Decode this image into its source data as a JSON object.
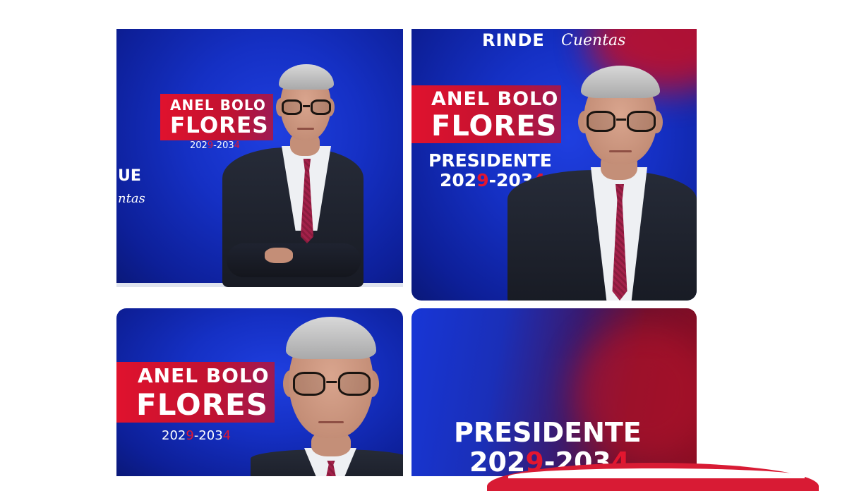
{
  "tile1": {
    "name_line1": "ANEL BOLO",
    "name_line2": "FLORES",
    "years_a": "202",
    "years_b": "9",
    "years_c": "-203",
    "years_d": "4",
    "edge_text1": "UE",
    "edge_text2": "ntas"
  },
  "tile2": {
    "rinde": "RINDE",
    "cuentas": "Cuentas",
    "name_line1": "ANEL BOLO",
    "name_line2": "FLORES",
    "presidente": "PRESIDENTE",
    "years_a": "202",
    "years_b": "9",
    "years_c": "-203",
    "years_d": "4",
    "edge_text": "P"
  },
  "tile3": {
    "name_line1": "ANEL BOLO",
    "name_line2": "FLORES",
    "years_a": "202",
    "years_b": "9",
    "years_c": "-203",
    "years_d": "4"
  },
  "tile4": {
    "presidente": "PRESIDENTE",
    "years_a": "202",
    "years_b": "9",
    "years_c": "-203",
    "years_d": "4"
  },
  "colors": {
    "accent_red": "#e3162f",
    "brand_blue": "#1530c4",
    "white": "#ffffff"
  }
}
